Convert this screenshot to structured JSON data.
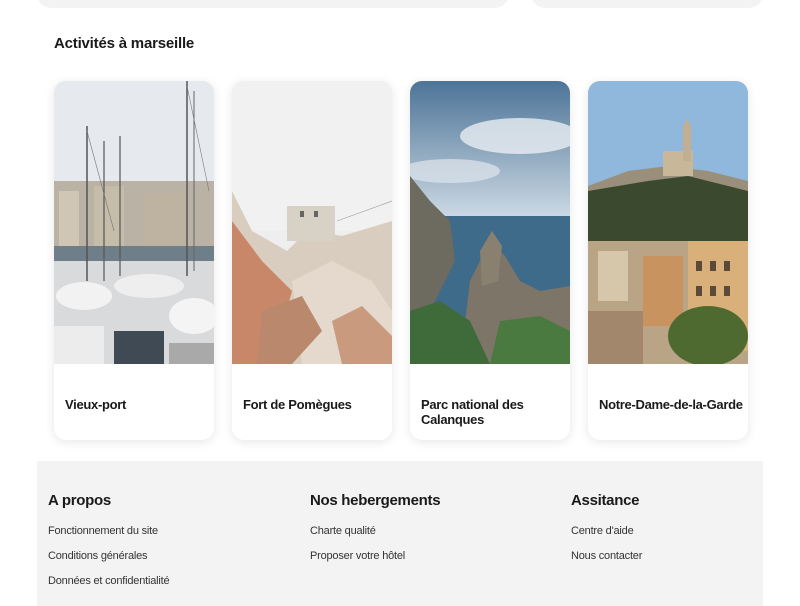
{
  "activities": {
    "title": "Activités à marseille",
    "cards": [
      {
        "label": "Vieux-port",
        "image": "marina-boats-photo"
      },
      {
        "label": "Fort de Pomègues",
        "image": "rocky-fort-photo"
      },
      {
        "label": "Parc national des Calanques",
        "image": "calanques-cliffs-photo"
      },
      {
        "label": "Notre-Dame-de-la-Garde",
        "image": "basilica-hill-photo"
      }
    ]
  },
  "footer": {
    "columns": [
      {
        "title": "A propos",
        "links": [
          "Fonctionnement du site",
          "Conditions générales",
          "Données et confidentialité"
        ]
      },
      {
        "title": "Nos hebergements",
        "links": [
          "Charte qualité",
          "Proposer votre hôtel"
        ]
      },
      {
        "title": "Assitance",
        "links": [
          "Centre d'aide",
          "Nous contacter"
        ]
      }
    ]
  },
  "colors": {
    "footer_bg": "#f3f3f3",
    "text": "#1a1a1a"
  }
}
